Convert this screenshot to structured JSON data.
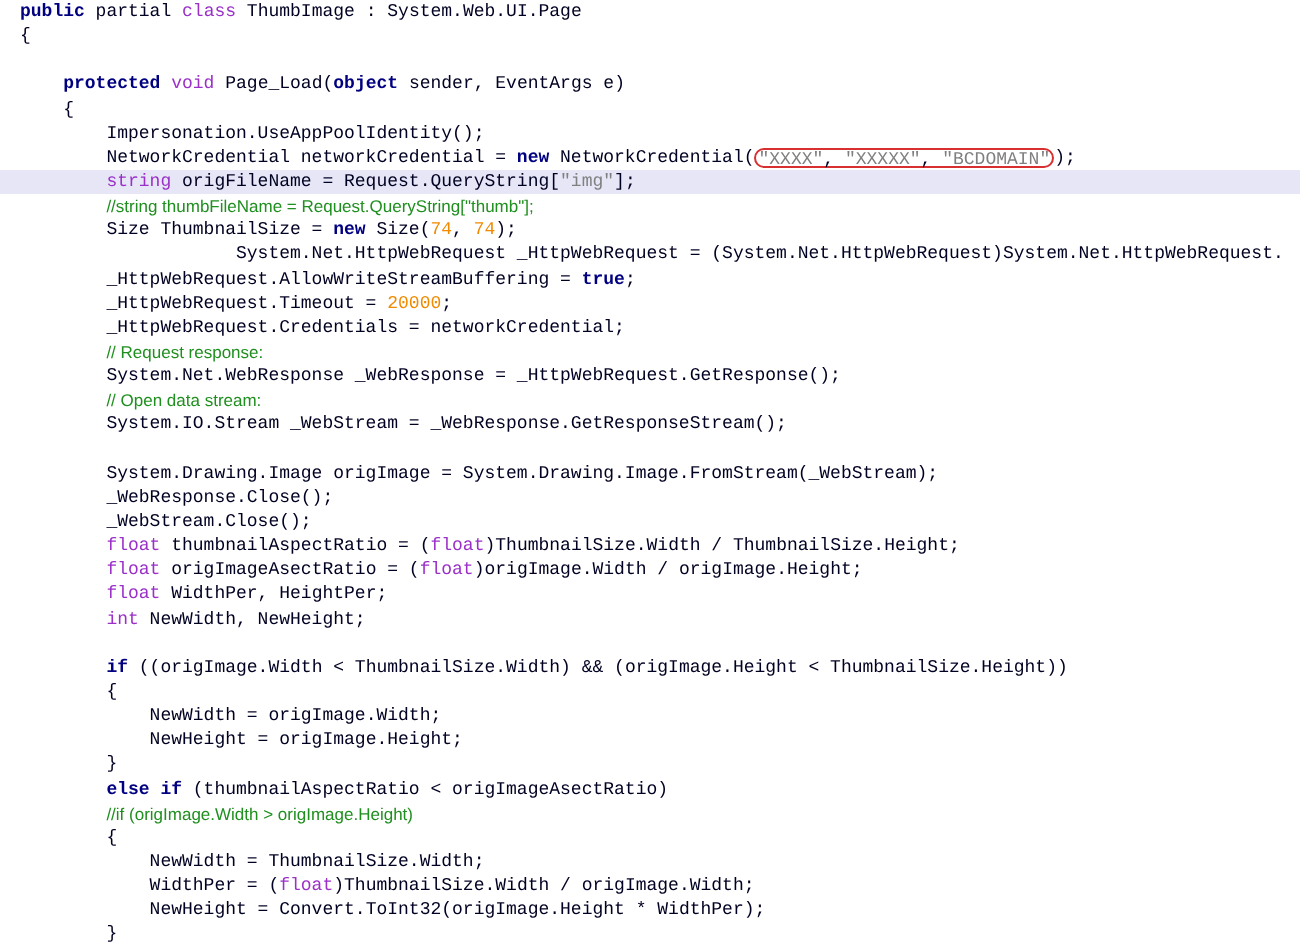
{
  "editor": {
    "lines": [
      {
        "kind": "code",
        "highlighted": false,
        "tokens": [
          {
            "kind": "keyword",
            "text": "public"
          },
          {
            "kind": "plain",
            "text": " partial "
          },
          {
            "kind": "type",
            "text": "class"
          },
          {
            "kind": "plain",
            "text": " ThumbImage : System.Web.UI.Page"
          }
        ]
      },
      {
        "kind": "code",
        "highlighted": false,
        "tokens": [
          {
            "kind": "plain",
            "text": "{"
          }
        ],
        "children": [
          {
            "kind": "blank",
            "highlighted": false
          },
          {
            "kind": "code",
            "highlighted": false,
            "tokens": [
              {
                "kind": "keyword",
                "text": "protected"
              },
              {
                "kind": "type",
                "text": " void"
              },
              {
                "kind": "plain",
                "text": " Page_Load("
              },
              {
                "kind": "keyword",
                "text": "object"
              },
              {
                "kind": "plain",
                "text": " sender, EventArgs e)"
              }
            ]
          },
          {
            "kind": "code",
            "highlighted": false,
            "tokens": [
              {
                "kind": "plain",
                "text": "{"
              }
            ],
            "children": [
              {
                "kind": "code",
                "highlighted": false,
                "tokens": [
                  {
                    "kind": "plain",
                    "text": "Impersonation.UseAppPoolIdentity();"
                  }
                ]
              },
              {
                "kind": "code",
                "highlighted": false,
                "tokens": [
                  {
                    "kind": "plain",
                    "text": "NetworkCredential networkCredential = "
                  },
                  {
                    "kind": "keyword",
                    "text": "new"
                  },
                  {
                    "kind": "plain",
                    "text": " NetworkCredential("
                  },
                  {
                    "kind": "circled",
                    "tokens": [
                      {
                        "kind": "string",
                        "text": "\"XXXX\""
                      },
                      {
                        "kind": "plain",
                        "text": ", "
                      },
                      {
                        "kind": "string",
                        "text": "\"XXXXX\""
                      },
                      {
                        "kind": "plain",
                        "text": ", "
                      },
                      {
                        "kind": "string",
                        "text": "\"BCDOMAIN\""
                      }
                    ]
                  },
                  {
                    "kind": "plain",
                    "text": ");"
                  }
                ]
              },
              {
                "kind": "code",
                "highlighted": true,
                "tokens": [
                  {
                    "kind": "type",
                    "text": "string"
                  },
                  {
                    "kind": "plain",
                    "text": " origFileName = Request.QueryString["
                  },
                  {
                    "kind": "string",
                    "text": "\"img\""
                  },
                  {
                    "kind": "plain",
                    "text": "];"
                  }
                ]
              },
              {
                "kind": "code",
                "highlighted": false,
                "tokens": [
                  {
                    "kind": "comment",
                    "text": "//string thumbFileName = Request.QueryString[\"thumb\"];"
                  }
                ]
              },
              {
                "kind": "code",
                "highlighted": false,
                "tokens": [
                  {
                    "kind": "plain",
                    "text": "Size ThumbnailSize = "
                  },
                  {
                    "kind": "keyword",
                    "text": "new"
                  },
                  {
                    "kind": "plain",
                    "text": " Size("
                  },
                  {
                    "kind": "number",
                    "text": "74"
                  },
                  {
                    "kind": "plain",
                    "text": ", "
                  },
                  {
                    "kind": "number",
                    "text": "74"
                  },
                  {
                    "kind": "plain",
                    "text": ");"
                  }
                ]
              },
              {
                "kind": "continuation",
                "highlighted": false,
                "tokens": [
                  {
                    "kind": "plain",
                    "text": "System.Net.HttpWebRequest _HttpWebRequest = (System.Net.HttpWebRequest)System.Net.HttpWebRequest."
                  }
                ]
              },
              {
                "kind": "code",
                "highlighted": false,
                "tokens": [
                  {
                    "kind": "plain",
                    "text": "_HttpWebRequest.AllowWriteStreamBuffering = "
                  },
                  {
                    "kind": "keyword",
                    "text": "true"
                  },
                  {
                    "kind": "plain",
                    "text": ";"
                  }
                ]
              },
              {
                "kind": "code",
                "highlighted": false,
                "tokens": [
                  {
                    "kind": "plain",
                    "text": "_HttpWebRequest.Timeout = "
                  },
                  {
                    "kind": "number",
                    "text": "20000"
                  },
                  {
                    "kind": "plain",
                    "text": ";"
                  }
                ]
              },
              {
                "kind": "code",
                "highlighted": false,
                "tokens": [
                  {
                    "kind": "plain",
                    "text": "_HttpWebRequest.Credentials = networkCredential;"
                  }
                ]
              },
              {
                "kind": "code",
                "highlighted": false,
                "tokens": [
                  {
                    "kind": "comment",
                    "text": "// Request response:"
                  }
                ]
              },
              {
                "kind": "code",
                "highlighted": false,
                "tokens": [
                  {
                    "kind": "plain",
                    "text": "System.Net.WebResponse _WebResponse = _HttpWebRequest.GetResponse();"
                  }
                ]
              },
              {
                "kind": "code",
                "highlighted": false,
                "tokens": [
                  {
                    "kind": "comment",
                    "text": "// Open data stream:"
                  }
                ]
              },
              {
                "kind": "code",
                "highlighted": false,
                "tokens": [
                  {
                    "kind": "plain",
                    "text": "System.IO.Stream _WebStream = _WebResponse.GetResponseStream();"
                  }
                ]
              },
              {
                "kind": "blank",
                "highlighted": false
              },
              {
                "kind": "code",
                "highlighted": false,
                "tokens": [
                  {
                    "kind": "plain",
                    "text": "System.Drawing.Image origImage = System.Drawing.Image.FromStream(_WebStream);"
                  }
                ]
              },
              {
                "kind": "code",
                "highlighted": false,
                "tokens": [
                  {
                    "kind": "plain",
                    "text": "_WebResponse.Close();"
                  }
                ]
              },
              {
                "kind": "code",
                "highlighted": false,
                "tokens": [
                  {
                    "kind": "plain",
                    "text": "_WebStream.Close();"
                  }
                ]
              },
              {
                "kind": "code",
                "highlighted": false,
                "tokens": [
                  {
                    "kind": "type",
                    "text": "float"
                  },
                  {
                    "kind": "plain",
                    "text": " thumbnailAspectRatio = ("
                  },
                  {
                    "kind": "type",
                    "text": "float"
                  },
                  {
                    "kind": "plain",
                    "text": ")ThumbnailSize.Width / ThumbnailSize.Height;"
                  }
                ]
              },
              {
                "kind": "code",
                "highlighted": false,
                "tokens": [
                  {
                    "kind": "type",
                    "text": "float"
                  },
                  {
                    "kind": "plain",
                    "text": " origImageAsectRatio = ("
                  },
                  {
                    "kind": "type",
                    "text": "float"
                  },
                  {
                    "kind": "plain",
                    "text": ")origImage.Width / origImage.Height;"
                  }
                ]
              },
              {
                "kind": "code",
                "highlighted": false,
                "tokens": [
                  {
                    "kind": "type",
                    "text": "float"
                  },
                  {
                    "kind": "plain",
                    "text": " WidthPer, HeightPer;"
                  }
                ]
              },
              {
                "kind": "code",
                "highlighted": false,
                "tokens": [
                  {
                    "kind": "type",
                    "text": "int"
                  },
                  {
                    "kind": "plain",
                    "text": " NewWidth, NewHeight;"
                  }
                ]
              },
              {
                "kind": "blank",
                "highlighted": false
              },
              {
                "kind": "code",
                "highlighted": false,
                "tokens": [
                  {
                    "kind": "keyword",
                    "text": "if"
                  },
                  {
                    "kind": "plain",
                    "text": " ((origImage.Width < ThumbnailSize.Width) && (origImage.Height < ThumbnailSize.Height))"
                  }
                ]
              },
              {
                "kind": "code",
                "highlighted": false,
                "tokens": [
                  {
                    "kind": "plain",
                    "text": "{"
                  }
                ],
                "children": [
                  {
                    "kind": "code",
                    "highlighted": false,
                    "tokens": [
                      {
                        "kind": "plain",
                        "text": "NewWidth = origImage.Width;"
                      }
                    ]
                  },
                  {
                    "kind": "code",
                    "highlighted": false,
                    "tokens": [
                      {
                        "kind": "plain",
                        "text": "NewHeight = origImage.Height;"
                      }
                    ]
                  }
                ]
              },
              {
                "kind": "code",
                "highlighted": false,
                "tokens": [
                  {
                    "kind": "plain",
                    "text": "}"
                  }
                ]
              },
              {
                "kind": "code",
                "highlighted": false,
                "tokens": [
                  {
                    "kind": "keyword",
                    "text": "else"
                  },
                  {
                    "kind": "keyword",
                    "text": " if"
                  },
                  {
                    "kind": "plain",
                    "text": " (thumbnailAspectRatio < origImageAsectRatio)"
                  }
                ]
              },
              {
                "kind": "code",
                "highlighted": false,
                "tokens": [
                  {
                    "kind": "comment",
                    "text": "//if (origImage.Width > origImage.Height)"
                  }
                ]
              },
              {
                "kind": "code",
                "highlighted": false,
                "tokens": [
                  {
                    "kind": "plain",
                    "text": "{"
                  }
                ],
                "children": [
                  {
                    "kind": "code",
                    "highlighted": false,
                    "tokens": [
                      {
                        "kind": "plain",
                        "text": "NewWidth = ThumbnailSize.Width;"
                      }
                    ]
                  },
                  {
                    "kind": "code",
                    "highlighted": false,
                    "tokens": [
                      {
                        "kind": "plain",
                        "text": "WidthPer = ("
                      },
                      {
                        "kind": "type",
                        "text": "float"
                      },
                      {
                        "kind": "plain",
                        "text": ")ThumbnailSize.Width / origImage.Width;"
                      }
                    ]
                  },
                  {
                    "kind": "code",
                    "highlighted": false,
                    "tokens": [
                      {
                        "kind": "plain",
                        "text": "NewHeight = Convert.ToInt32(origImage.Height * WidthPer);"
                      }
                    ]
                  }
                ]
              },
              {
                "kind": "code",
                "highlighted": false,
                "tokens": [
                  {
                    "kind": "plain",
                    "text": "}"
                  }
                ]
              }
            ]
          }
        ]
      }
    ]
  }
}
